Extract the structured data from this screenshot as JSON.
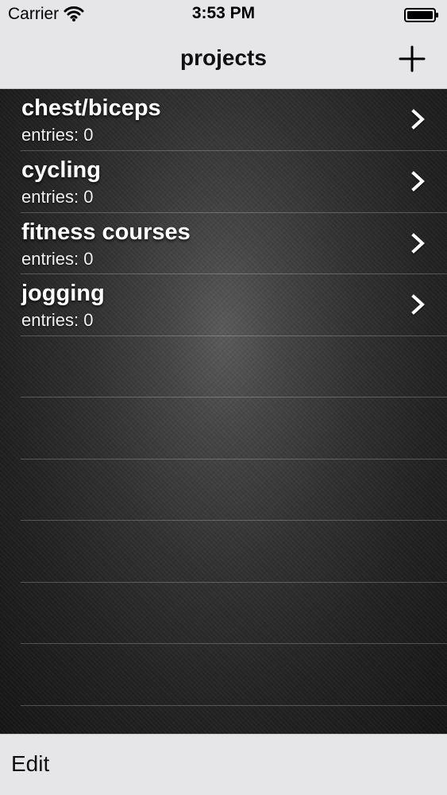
{
  "status_bar": {
    "carrier": "Carrier",
    "time": "3:53 PM",
    "wifi_icon": "wifi-icon",
    "battery_icon": "battery-icon"
  },
  "nav_bar": {
    "title": "projects",
    "add_icon": "plus-icon"
  },
  "projects": [
    {
      "title": "chest/biceps",
      "subtitle": "entries: 0",
      "chevron_icon": "chevron-right-icon"
    },
    {
      "title": "cycling",
      "subtitle": "entries: 0",
      "chevron_icon": "chevron-right-icon"
    },
    {
      "title": "fitness courses",
      "subtitle": "entries: 0",
      "chevron_icon": "chevron-right-icon"
    },
    {
      "title": "jogging",
      "subtitle": "entries: 0",
      "chevron_icon": "chevron-right-icon"
    }
  ],
  "toolbar": {
    "edit_label": "Edit"
  },
  "colors": {
    "bar_background": "#e6e6e8",
    "content_dark": "#222222",
    "row_text": "#ffffff",
    "separator": "#6a6a6a"
  }
}
